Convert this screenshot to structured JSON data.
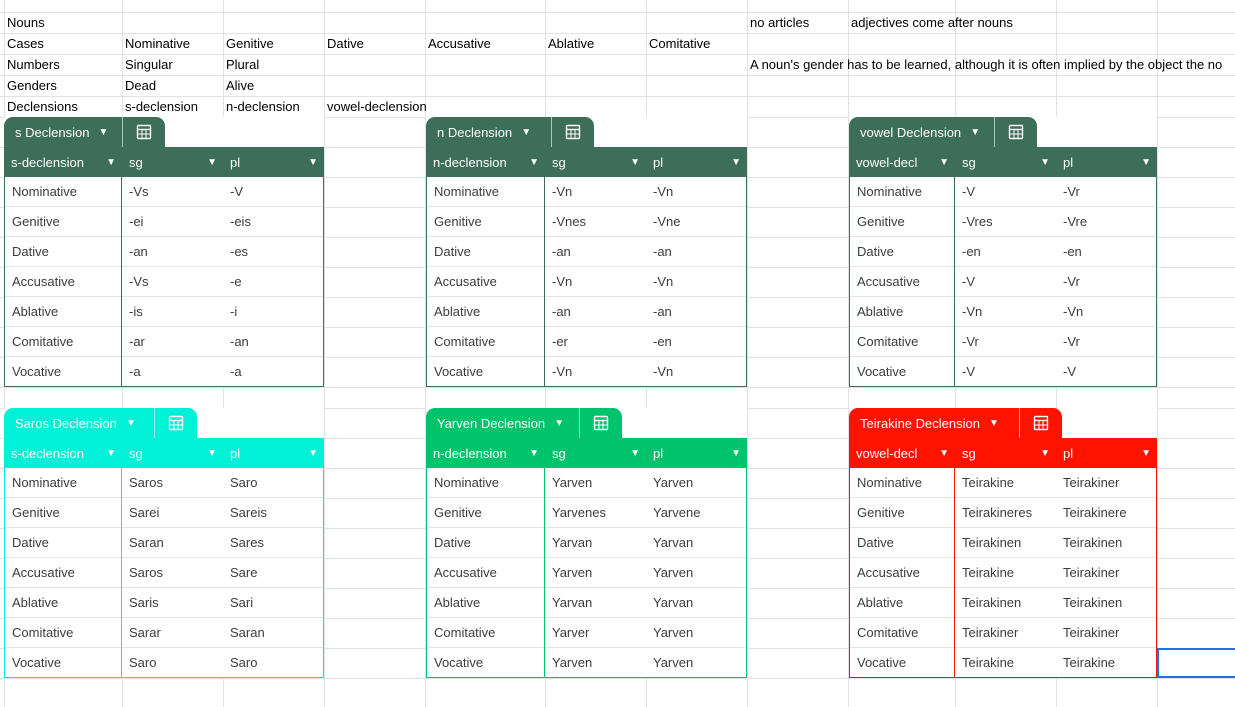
{
  "colors": {
    "green": "#3d6e59",
    "teal": "#00f0d8",
    "mint": "#00c46c",
    "red": "#ff1200",
    "gridline": "#e2e2e2"
  },
  "grid_rows": [
    {
      "a": "Nouns",
      "b": "",
      "c": "",
      "d": "",
      "e": "",
      "f": "",
      "g": "",
      "h": "no articles",
      "i": "adjectives come after nouns"
    },
    {
      "a": "Cases",
      "b": "Nominative",
      "c": "Genitive",
      "d": "Dative",
      "e": "Accusative",
      "f": "Ablative",
      "g": "Comitative",
      "h": "",
      "i": ""
    },
    {
      "a": "Numbers",
      "b": "Singular",
      "c": "Plural",
      "d": "",
      "e": "",
      "f": "",
      "g": "",
      "h": "A noun's gender has to be learned, although it is often implied by the object the no",
      "i": ""
    },
    {
      "a": "Genders",
      "b": "Dead",
      "c": "Alive",
      "d": "",
      "e": "",
      "f": "",
      "g": "",
      "h": "",
      "i": ""
    },
    {
      "a": "Declensions",
      "b": "s-declension",
      "c": "n-declension",
      "d": "vowel-declension",
      "e": "",
      "f": "",
      "g": "",
      "h": "",
      "i": ""
    }
  ],
  "tables": [
    {
      "id": "s",
      "title": "s Declension",
      "color": "green",
      "headers": [
        "s-declension",
        "sg",
        "pl"
      ],
      "rows": [
        [
          "Nominative",
          "-Vs",
          "-V"
        ],
        [
          "Genitive",
          "-ei",
          "-eis"
        ],
        [
          "Dative",
          "-an",
          "-es"
        ],
        [
          "Accusative",
          "-Vs",
          "-e"
        ],
        [
          "Ablative",
          "-is",
          "-i"
        ],
        [
          "Comitative",
          "-ar",
          "-an"
        ],
        [
          "Vocative",
          "-a",
          "-a"
        ]
      ]
    },
    {
      "id": "n",
      "title": "n Declension",
      "color": "green",
      "headers": [
        "n-declension",
        "sg",
        "pl"
      ],
      "rows": [
        [
          "Nominative",
          "-Vn",
          "-Vn"
        ],
        [
          "Genitive",
          "-Vnes",
          "-Vne"
        ],
        [
          "Dative",
          "-an",
          "-an"
        ],
        [
          "Accusative",
          "-Vn",
          "-Vn"
        ],
        [
          "Ablative",
          "-an",
          "-an"
        ],
        [
          "Comitative",
          "-er",
          "-en"
        ],
        [
          "Vocative",
          "-Vn",
          "-Vn"
        ]
      ]
    },
    {
      "id": "vowel",
      "title": "vowel Declension",
      "color": "green",
      "headers": [
        "vowel-decl",
        "sg",
        "pl"
      ],
      "rows": [
        [
          "Nominative",
          "-V",
          "-Vr"
        ],
        [
          "Genitive",
          "-Vres",
          "-Vre"
        ],
        [
          "Dative",
          "-en",
          "-en"
        ],
        [
          "Accusative",
          "-V",
          "-Vr"
        ],
        [
          "Ablative",
          "-Vn",
          "-Vn"
        ],
        [
          "Comitative",
          "-Vr",
          "-Vr"
        ],
        [
          "Vocative",
          "-V",
          "-V"
        ]
      ]
    },
    {
      "id": "saros",
      "title": "Saros Declension",
      "color": "teal",
      "headers": [
        "s-declension",
        "sg",
        "pl"
      ],
      "rows": [
        [
          "Nominative",
          "Saros",
          "Saro"
        ],
        [
          "Genitive",
          "Sarei",
          "Sareis"
        ],
        [
          "Dative",
          "Saran",
          "Sares"
        ],
        [
          "Accusative",
          "Saros",
          "Sare"
        ],
        [
          "Ablative",
          "Saris",
          "Sari"
        ],
        [
          "Comitative",
          "Sarar",
          "Saran"
        ],
        [
          "Vocative",
          "Saro",
          "Saro"
        ]
      ]
    },
    {
      "id": "yarven",
      "title": "Yarven Declension",
      "color": "mint",
      "headers": [
        "n-declension",
        "sg",
        "pl"
      ],
      "rows": [
        [
          "Nominative",
          "Yarven",
          "Yarven"
        ],
        [
          "Genitive",
          "Yarvenes",
          "Yarvene"
        ],
        [
          "Dative",
          "Yarvan",
          "Yarvan"
        ],
        [
          "Accusative",
          "Yarven",
          "Yarven"
        ],
        [
          "Ablative",
          "Yarvan",
          "Yarvan"
        ],
        [
          "Comitative",
          "Yarver",
          "Yarven"
        ],
        [
          "Vocative",
          "Yarven",
          "Yarven"
        ]
      ]
    },
    {
      "id": "teirakine",
      "title": "Teirakine Declension",
      "color": "red",
      "headers": [
        "vowel-decl",
        "sg",
        "pl"
      ],
      "rows": [
        [
          "Nominative",
          "Teirakine",
          "Teirakiner"
        ],
        [
          "Genitive",
          "Teirakineres",
          "Teirakinere"
        ],
        [
          "Dative",
          "Teirakinen",
          "Teirakinen"
        ],
        [
          "Accusative",
          "Teirakine",
          "Teirakiner"
        ],
        [
          "Ablative",
          "Teirakinen",
          "Teirakinen"
        ],
        [
          "Comitative",
          "Teirakiner",
          "Teirakiner"
        ],
        [
          "Vocative",
          "Teirakine",
          "Teirakine"
        ]
      ]
    }
  ],
  "icons": {
    "dropdown": "chevron-down-icon",
    "table_menu": "table-calculator-icon"
  }
}
